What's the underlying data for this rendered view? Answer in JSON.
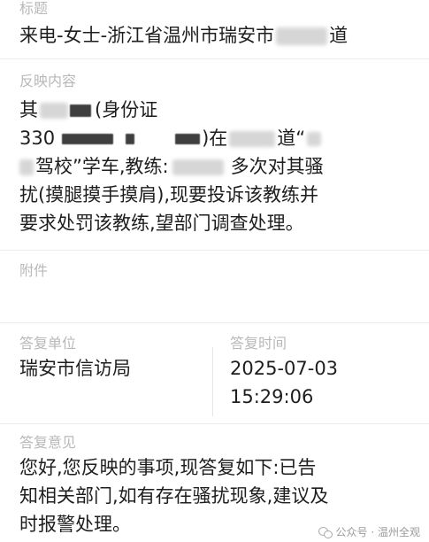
{
  "title": {
    "label": "标题",
    "value_prefix": "来电-女士-浙江省温州市瑞安市",
    "value_suffix": "道"
  },
  "content": {
    "label": "反映内容",
    "line1_prefix": "其",
    "line1_suffix": "(身份证",
    "line2_prefix": "330",
    "line2_mid": ")在",
    "line2_suffix": "道“",
    "line3_suffix": "驾校”学车,教练:",
    "line3_end": "多次对其骚",
    "line4": "扰(摸腿摸手摸肩),现要投诉该教练并",
    "line5": "要求处罚该教练,望部门调查处理。"
  },
  "attachment": {
    "label": "附件"
  },
  "reply_unit": {
    "label": "答复单位",
    "value": "瑞安市信访局"
  },
  "reply_time": {
    "label": "答复时间",
    "date": "2025-07-03",
    "time": "15:29:06"
  },
  "reply_opinion": {
    "label": "答复意见",
    "line1": "您好,您反映的事项,现答复如下:已告",
    "line2": "知相关部门,如有存在骚扰现象,建议及",
    "line3": "时报警处理。"
  },
  "watermark": {
    "text": "公众号 · 温州全观",
    "icon": "wechat-icon"
  }
}
